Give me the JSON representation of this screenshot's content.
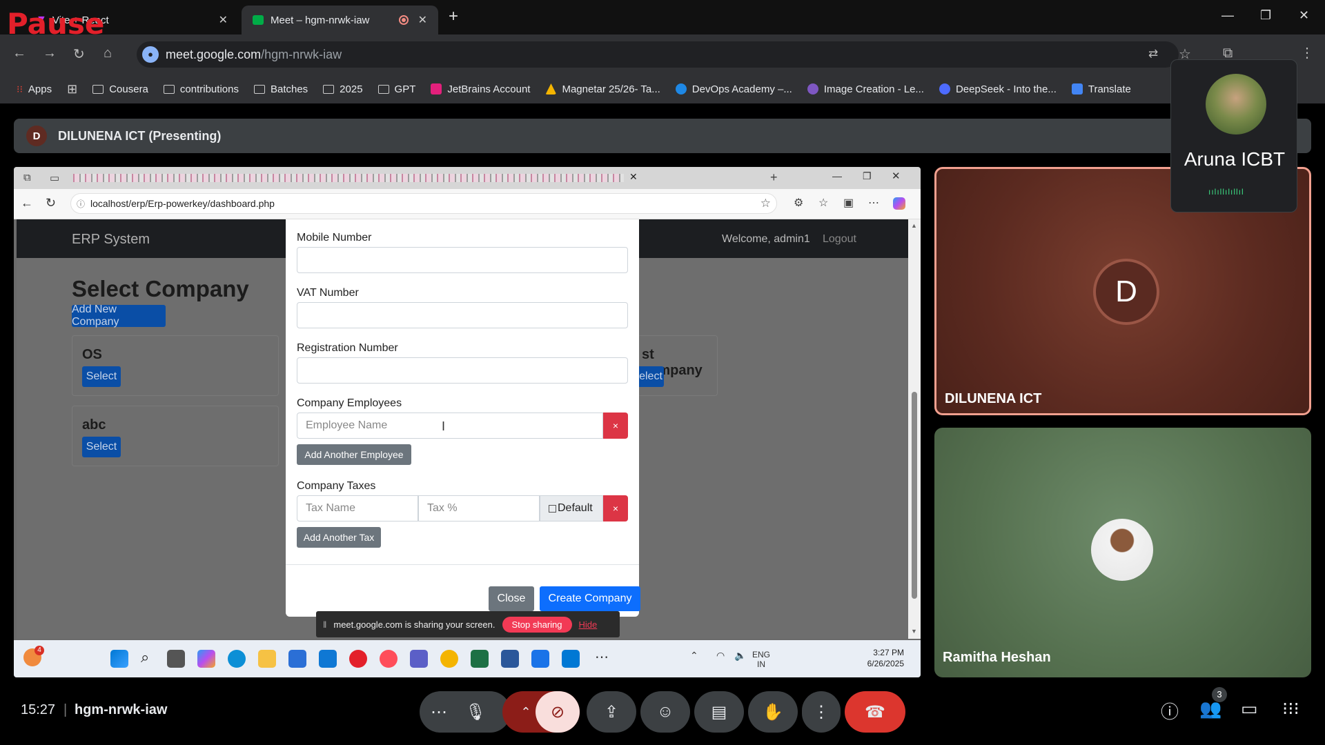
{
  "browser": {
    "pause_overlay": "Pause",
    "tabs": [
      {
        "title": "Vite + React",
        "active": false
      },
      {
        "title": "Meet – hgm-nrwk-iaw",
        "active": true,
        "recording": true
      }
    ],
    "url_domain": "meet.google.com",
    "url_path": "/hgm-nrwk-iaw",
    "bookmarks": [
      {
        "label": "Apps",
        "icon": "apps-grid-icon"
      },
      {
        "label": "Cousera",
        "icon": "folder-icon"
      },
      {
        "label": "contributions",
        "icon": "folder-icon"
      },
      {
        "label": "Batches",
        "icon": "folder-icon"
      },
      {
        "label": "2025",
        "icon": "folder-icon"
      },
      {
        "label": "GPT",
        "icon": "folder-icon"
      },
      {
        "label": "JetBrains Account",
        "icon": "jetbrains-icon",
        "color": "#e3207c"
      },
      {
        "label": "Magnetar 25/26- Ta...",
        "icon": "drive-icon",
        "color": "#f4b400"
      },
      {
        "label": "DevOps Academy –...",
        "icon": "devops-icon",
        "color": "#1e88e5"
      },
      {
        "label": "Image Creation - Le...",
        "icon": "image-icon",
        "color": "#7e57c2"
      },
      {
        "label": "DeepSeek - Into the...",
        "icon": "deepseek-icon",
        "color": "#4d6bfe"
      },
      {
        "label": "Translate",
        "icon": "translate-icon",
        "color": "#4285f4"
      }
    ]
  },
  "meet": {
    "presenter_initial": "D",
    "presenter_label": "DILUNENA ICT (Presenting)",
    "meeting_time": "15:27",
    "meeting_code": "hgm-nrwk-iaw",
    "participant_count": "3",
    "tiles": [
      {
        "name": "DILUNENA ICT",
        "initial": "D",
        "speaking_border": "#f2a08f"
      },
      {
        "name": "Ramitha Heshan"
      }
    ],
    "floating_tile": {
      "name": "Aruna ICBT",
      "audio_bars": "ıılıllılıllıl"
    }
  },
  "shared_screen": {
    "url": "localhost/erp/Erp-powerkey/dashboard.php",
    "erp": {
      "brand": "ERP System",
      "welcome": "Welcome, admin1",
      "logout": "Logout",
      "page_title": "Select Company",
      "add_button": "Add New Company",
      "companies": [
        {
          "name": "OS",
          "button": "Select"
        },
        {
          "name": "st company",
          "button": "elect"
        },
        {
          "name": "abc",
          "button": "Select"
        }
      ]
    },
    "modal": {
      "mobile_label": "Mobile Number",
      "vat_label": "VAT Number",
      "reg_label": "Registration Number",
      "employees_label": "Company Employees",
      "employee_placeholder": "Employee Name",
      "remove_symbol": "×",
      "add_employee": "Add Another Employee",
      "taxes_label": "Company Taxes",
      "tax_name_placeholder": "Tax Name",
      "tax_percent_placeholder": "Tax %",
      "default_label": "Default",
      "add_tax": "Add Another Tax",
      "close": "Close",
      "create": "Create Company"
    },
    "share_notice": {
      "text": "meet.google.com is sharing your screen.",
      "stop": "Stop sharing",
      "hide": "Hide"
    },
    "taskbar": {
      "notification_badge": "4",
      "lang": "ENG",
      "region": "IN",
      "time": "3:27 PM",
      "date": "6/26/2025"
    }
  }
}
